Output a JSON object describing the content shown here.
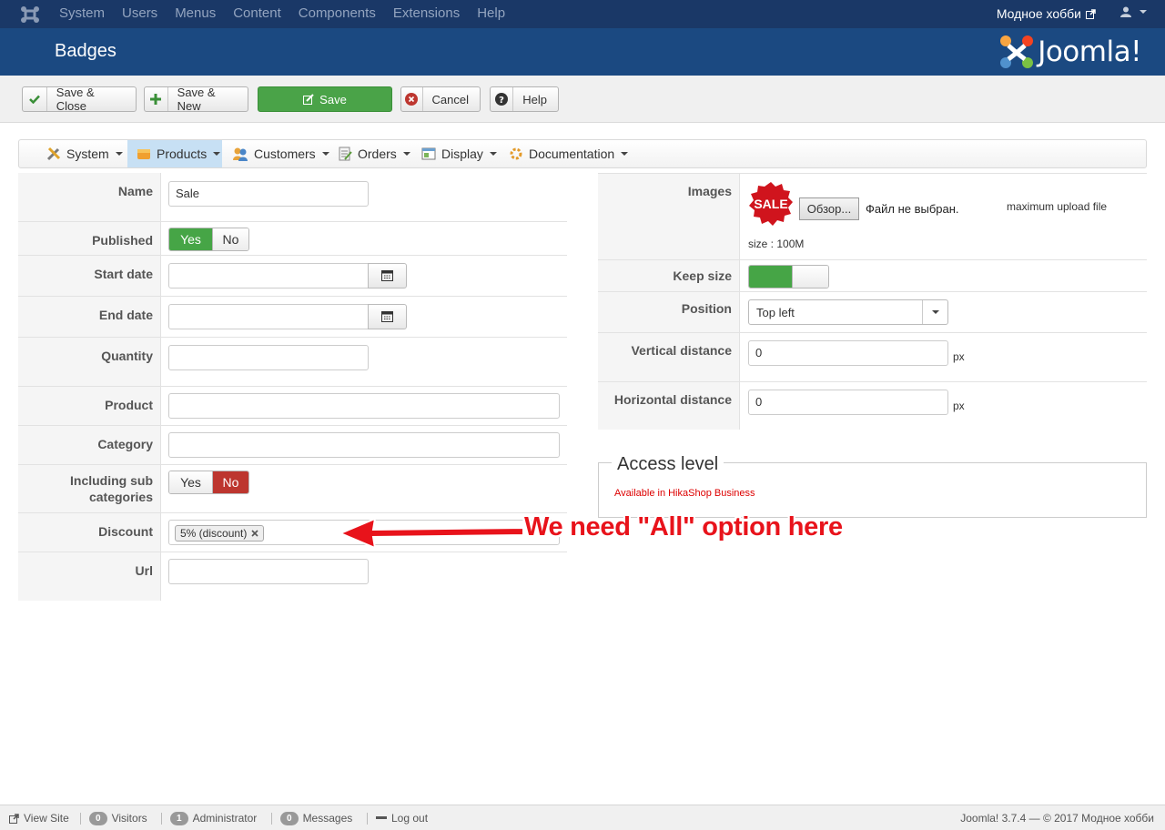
{
  "topbar": {
    "menu": [
      "System",
      "Users",
      "Menus",
      "Content",
      "Components",
      "Extensions",
      "Help"
    ],
    "site_name": "Модное хобби"
  },
  "header": {
    "title": "Badges",
    "brand": "Joomla!"
  },
  "toolbar": {
    "save_close": "Save & Close",
    "save_new": "Save & New",
    "save": "Save",
    "cancel": "Cancel",
    "help": "Help"
  },
  "nav": [
    "System",
    "Products",
    "Customers",
    "Orders",
    "Display",
    "Documentation"
  ],
  "form_left": {
    "name_label": "Name",
    "name_value": "Sale",
    "published_label": "Published",
    "yes": "Yes",
    "no": "No",
    "start_date_label": "Start date",
    "end_date_label": "End date",
    "quantity_label": "Quantity",
    "product_label": "Product",
    "category_label": "Category",
    "including_sub_label": "Including sub categories",
    "discount_label": "Discount",
    "discount_tag": "5% (discount)",
    "url_label": "Url"
  },
  "form_right": {
    "images_label": "Images",
    "sale_badge": "SALE",
    "browse_button": "Обзор...",
    "no_file": "Файл не выбран.",
    "max_upload": "maximum upload file",
    "size": "size : 100M",
    "keep_size_label": "Keep size",
    "position_label": "Position",
    "position_value": "Top left",
    "vertical_label": "Vertical distance",
    "vertical_value": "0",
    "horizontal_label": "Horizontal distance",
    "horizontal_value": "0",
    "px": "px"
  },
  "access": {
    "legend": "Access level",
    "note": "Available in HikaShop Business"
  },
  "annotation": "We need \"All\" option here",
  "status": {
    "view_site": "View Site",
    "visitors_count": "0",
    "visitors": "Visitors",
    "admin_count": "1",
    "admin": "Administrator",
    "messages_count": "0",
    "messages": "Messages",
    "logout": "Log out",
    "version": "Joomla! 3.7.4 — © 2017 Модное хобби"
  },
  "colors": {
    "topbar": "#1a3867",
    "header": "#1b4981",
    "save_green": "#4aa348",
    "toggle_red": "#bd362f",
    "annotation_red": "#e8131b"
  }
}
